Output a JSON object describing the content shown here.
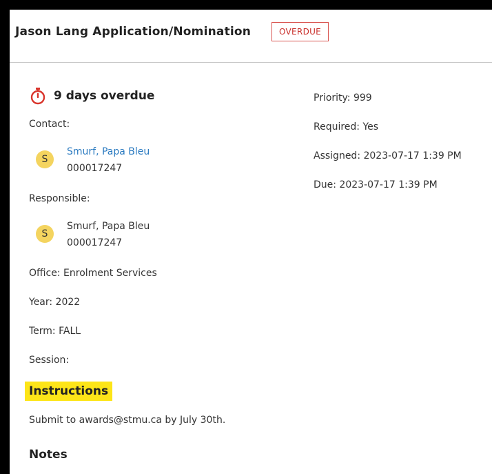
{
  "header": {
    "title": "Jason Lang Application/Nomination",
    "status_badge": "OVERDUE"
  },
  "overdue": {
    "text": "9 days overdue",
    "icon": "stopwatch-icon",
    "icon_color": "#d9342b"
  },
  "contact": {
    "label": "Contact:",
    "initial": "S",
    "name": "Smurf, Papa Bleu",
    "id": "000017247"
  },
  "responsible": {
    "label": "Responsible:",
    "initial": "S",
    "name": "Smurf, Papa Bleu",
    "id": "000017247"
  },
  "details": {
    "office": "Office: Enrolment Services",
    "year": "Year: 2022",
    "term": "Term: FALL",
    "session": "Session:"
  },
  "instructions": {
    "heading": "Instructions",
    "text": "Submit to awards@stmu.ca by July 30th."
  },
  "notes": {
    "heading": "Notes"
  },
  "right": {
    "priority": "Priority: 999",
    "required": "Required: Yes",
    "assigned": "Assigned: 2023-07-17 1:39 PM",
    "due": "Due: 2023-07-17 1:39 PM"
  },
  "colors": {
    "badge": "#c9302c",
    "link": "#2a7ac0",
    "avatar": "#f4d45f",
    "highlight": "#fde518"
  }
}
